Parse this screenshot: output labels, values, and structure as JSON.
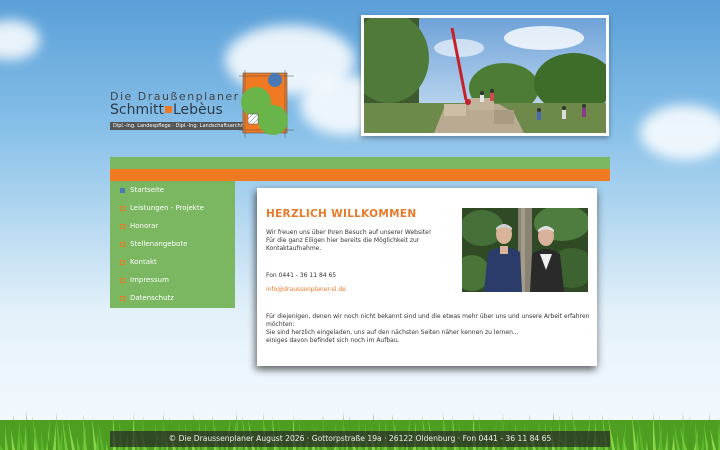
{
  "logo": {
    "line1": "Die Draußenplaner",
    "name_left": "Schmitt",
    "name_right": "Lebèus",
    "tagline": "Dipl.-Ing. Landespflege · Dipl.-Ing. Landschaftsarchitekt"
  },
  "nav": {
    "items": [
      {
        "label": "Startseite",
        "active": true
      },
      {
        "label": "Leistungen - Projekte",
        "active": false
      },
      {
        "label": "Honorar",
        "active": false
      },
      {
        "label": "Stellenangebote",
        "active": false
      },
      {
        "label": "Kontakt",
        "active": false
      },
      {
        "label": "Impressum",
        "active": false
      },
      {
        "label": "Datenschutz",
        "active": false
      }
    ]
  },
  "main": {
    "title": "HERZLICH WILLKOMMEN",
    "intro_line1": "Wir freuen uns über Ihren Besuch auf unserer Website!",
    "intro_line2": "Für die ganz Eiligen hier bereits die Möglichkeit zur",
    "intro_line3": "Kontaktaufnahme.",
    "phone": "Fon 0441 - 36 11 84 65",
    "email": "info@draussenplaner-sl.de",
    "para_line1": "Für diejenigen, denen wir noch nicht bekannt sind und die etwas mehr über uns und unsere Arbeit erfahren",
    "para_line2": "möchten:",
    "para_line3": "Sie sind herzlich eingeladen, uns auf den nächsten Seiten näher kennen zu lernen...",
    "para_line4": "einiges davon befindet sich noch im Aufbau."
  },
  "footer": {
    "text": "© Die Draussenplaner August 2026 · Gottorpstraße 19a · 26122 Oldenburg · Fon 0441 - 36 11 84 65"
  },
  "colors": {
    "green": "#7bb661",
    "orange": "#f07a22",
    "accent_text": "#e8792a",
    "sky": "#86bfe8"
  }
}
